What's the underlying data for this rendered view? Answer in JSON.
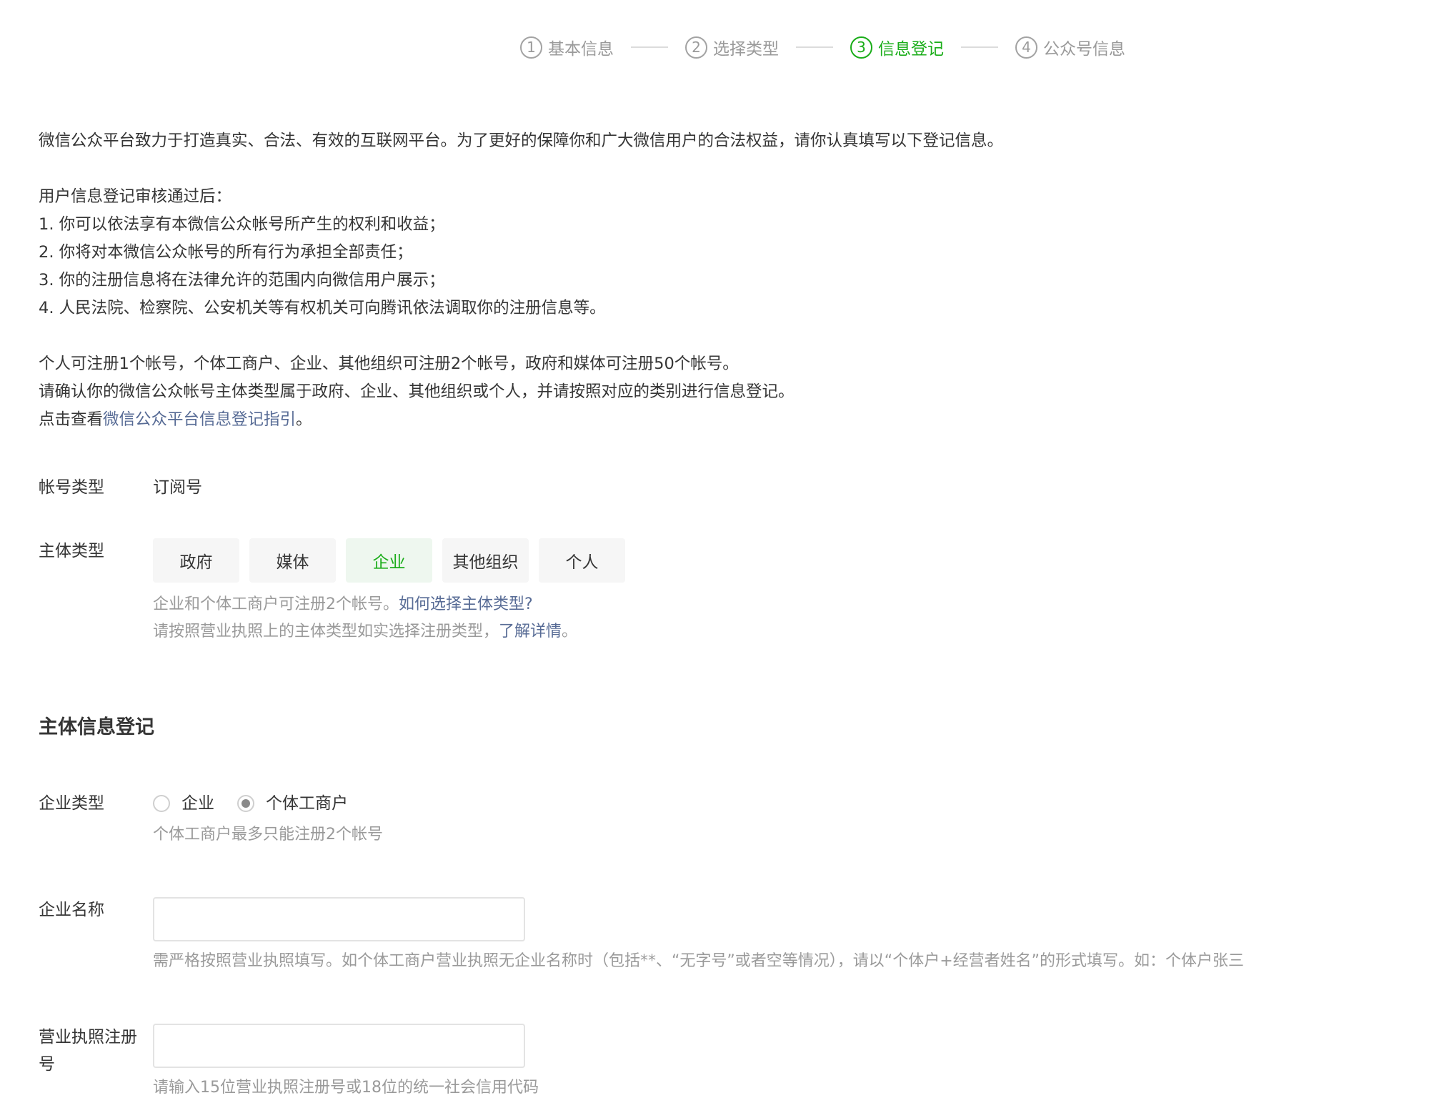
{
  "steps": [
    {
      "num": "1",
      "label": "基本信息"
    },
    {
      "num": "2",
      "label": "选择类型"
    },
    {
      "num": "3",
      "label": "信息登记"
    },
    {
      "num": "4",
      "label": "公众号信息"
    }
  ],
  "intro": {
    "line1": "微信公众平台致力于打造真实、合法、有效的互联网平台。为了更好的保障你和广大微信用户的合法权益，请你认真填写以下登记信息。",
    "after_title": "用户信息登记审核通过后：",
    "items": [
      "1. 你可以依法享有本微信公众帐号所产生的权利和收益；",
      "2. 你将对本微信公众帐号的所有行为承担全部责任；",
      "3. 你的注册信息将在法律允许的范围内向微信用户展示；",
      "4. 人民法院、检察院、公安机关等有权机关可向腾讯依法调取你的注册信息等。"
    ],
    "quota": "个人可注册1个帐号，个体工商户、企业、其他组织可注册2个帐号，政府和媒体可注册50个帐号。",
    "confirm": "请确认你的微信公众帐号主体类型属于政府、企业、其他组织或个人，并请按照对应的类别进行信息登记。",
    "guide_prefix": "点击查看",
    "guide_link": "微信公众平台信息登记指引",
    "guide_suffix": "。"
  },
  "account_type": {
    "label": "帐号类型",
    "value": "订阅号"
  },
  "subject_type": {
    "label": "主体类型",
    "options": [
      "政府",
      "媒体",
      "企业",
      "其他组织",
      "个人"
    ],
    "selected": "企业",
    "tip1_text": "企业和个体工商户可注册2个帐号。",
    "tip1_link": "如何选择主体类型?",
    "tip2_text": "请按照营业执照上的主体类型如实选择注册类型，",
    "tip2_link": "了解详情",
    "tip2_suffix": "。"
  },
  "section_title": "主体信息登记",
  "enterprise_type": {
    "label": "企业类型",
    "options": [
      "企业",
      "个体工商户"
    ],
    "selected": "个体工商户",
    "hint": "个体工商户最多只能注册2个帐号"
  },
  "enterprise_name": {
    "label": "企业名称",
    "value": "",
    "hint": "需严格按照营业执照填写。如个体工商户营业执照无企业名称时（包括**、“无字号”或者空等情况），请以“个体户+经营者姓名”的形式填写。如：个体户张三"
  },
  "license_number": {
    "label": "营业执照注册号",
    "value": "",
    "hint": "请输入15位营业执照注册号或18位的统一社会信用代码"
  },
  "colors": {
    "accent": "#1aad19",
    "link": "#576b95",
    "muted": "#9a9a9a"
  }
}
